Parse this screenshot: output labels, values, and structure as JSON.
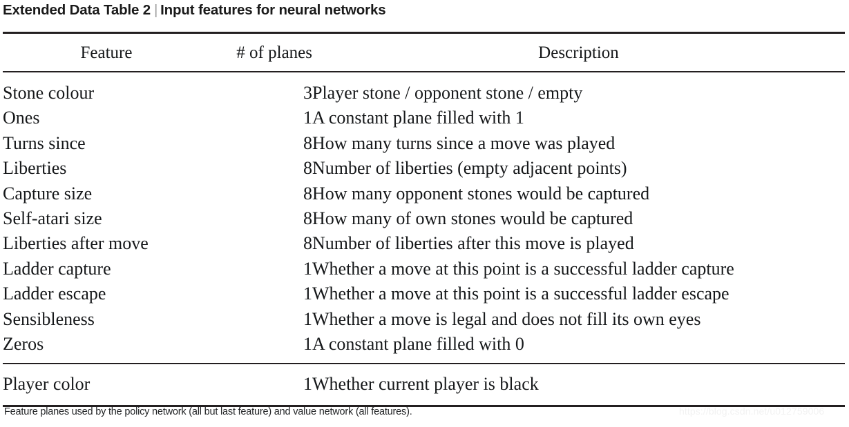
{
  "title": {
    "label": "Extended Data Table 2",
    "separator": "|",
    "subtitle": "Input features for neural networks"
  },
  "table": {
    "columns": {
      "feature": "Feature",
      "planes": "# of planes",
      "description": "Description"
    },
    "rows": [
      {
        "feature": "Stone colour",
        "planes": "3",
        "description": "Player stone / opponent stone / empty"
      },
      {
        "feature": "Ones",
        "planes": "1",
        "description": "A constant plane filled with 1"
      },
      {
        "feature": "Turns since",
        "planes": "8",
        "description": "How many turns since a move was played"
      },
      {
        "feature": "Liberties",
        "planes": "8",
        "description": "Number of liberties (empty adjacent points)"
      },
      {
        "feature": "Capture size",
        "planes": "8",
        "description": "How many opponent stones would be captured"
      },
      {
        "feature": "Self-atari size",
        "planes": "8",
        "description": "How many of own stones would be captured"
      },
      {
        "feature": "Liberties after move",
        "planes": "8",
        "description": "Number of liberties after this move is played"
      },
      {
        "feature": "Ladder capture",
        "planes": "1",
        "description": "Whether a move at this point is a successful ladder capture"
      },
      {
        "feature": "Ladder escape",
        "planes": "1",
        "description": "Whether a move at this point is a successful ladder escape"
      },
      {
        "feature": "Sensibleness",
        "planes": "1",
        "description": "Whether a move is legal and does not fill its own eyes"
      },
      {
        "feature": "Zeros",
        "planes": "1",
        "description": "A constant plane filled with 0"
      }
    ],
    "last_row": {
      "feature": "Player color",
      "planes": "1",
      "description": "Whether current player is black"
    }
  },
  "footnote": "Feature planes used by the policy network (all but last feature) and value network (all features).",
  "watermark": "https://blog.csdn.net/u012759006",
  "colors": {
    "rule": "#231f20",
    "text": "#16181a",
    "separator": "#9b9b9b",
    "watermark": "#f2f2f2"
  }
}
